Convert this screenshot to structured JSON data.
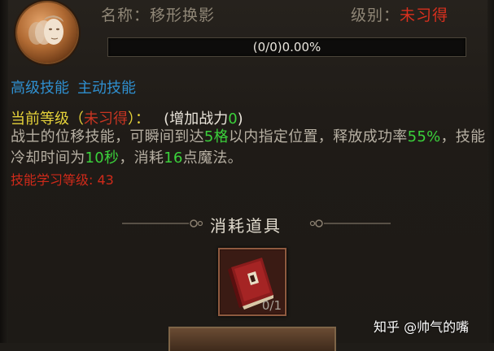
{
  "skill": {
    "name_prefix": "名称：",
    "name": "移形换影",
    "level_prefix": "级别：",
    "level_value": "未习得",
    "progress_text": "(0/0)0.00%",
    "progress_fraction": 0.0
  },
  "tags": {
    "grade": "高级技能",
    "kind": "主动技能"
  },
  "current": {
    "prefix": "当前等级（",
    "level": "未习得",
    "suffix": "）：",
    "power_prefix": "(增加战力",
    "power_value": "0",
    "power_suffix": ")"
  },
  "description": {
    "p1": "战士的位移技能，可瞬间到达",
    "v1": "5格",
    "p2": "以内指定位置，释放成功率",
    "v2": "55%",
    "p3": "，技能冷却时间为",
    "v3": "10秒",
    "p4": "，消耗",
    "v4": "16",
    "p5": "点魔法。"
  },
  "requirement": "技能学习等级: 43",
  "consume": {
    "title": "消耗道具",
    "item_count": "0/1"
  },
  "watermark": "知乎 @帅气的嘴",
  "colors": {
    "accent_red": "#d9301e",
    "accent_green": "#3bd13b",
    "accent_blue": "#2f8fcf",
    "accent_yellow": "#e6d23a"
  }
}
